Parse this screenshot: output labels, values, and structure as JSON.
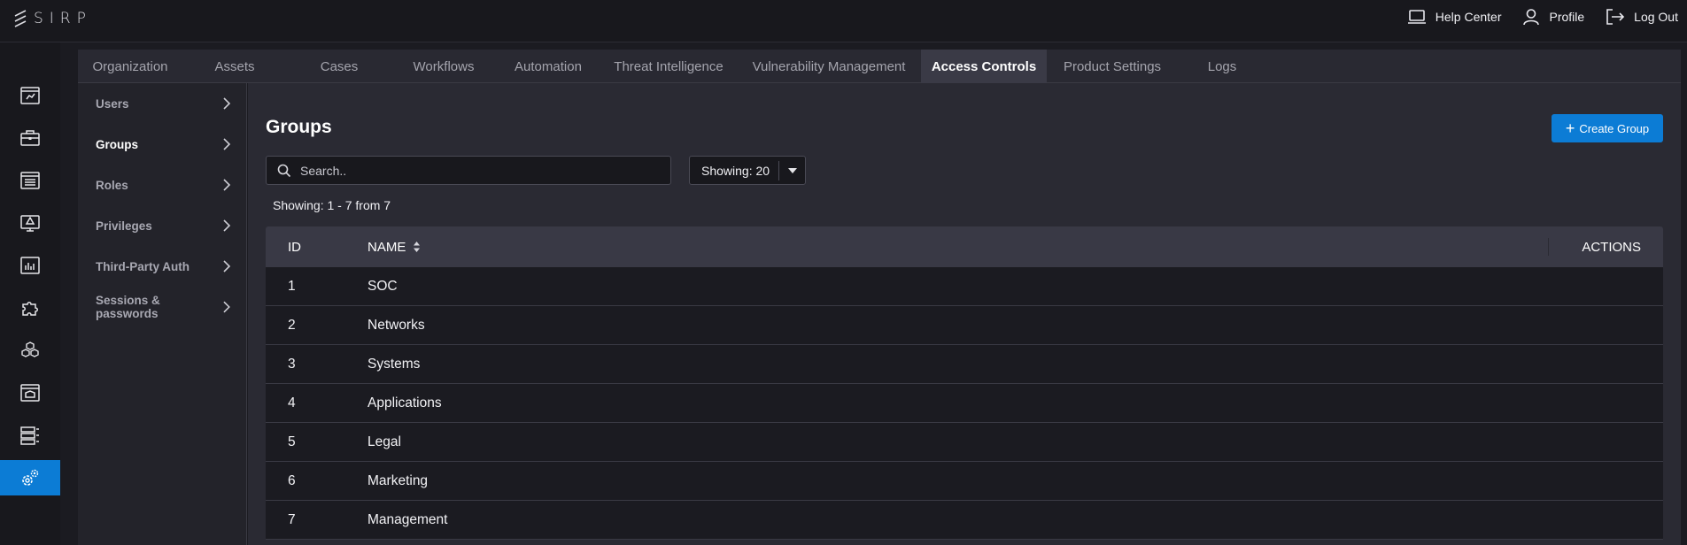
{
  "app": {
    "logo_text": "SIRP"
  },
  "top_actions": [
    {
      "label": "Help Center",
      "icon": "laptop-icon"
    },
    {
      "label": "Profile",
      "icon": "user-icon"
    },
    {
      "label": "Log Out",
      "icon": "logout-icon"
    }
  ],
  "rail": [
    "dashboard-icon",
    "briefcase-icon",
    "list-icon",
    "monitor-alert-icon",
    "analytics-icon",
    "puzzle-icon",
    "cubes-icon",
    "browser-window-icon",
    "server-icon",
    "settings-gears-icon"
  ],
  "tabs": [
    {
      "label": "Organization"
    },
    {
      "label": "Assets"
    },
    {
      "label": "Cases"
    },
    {
      "label": "Workflows"
    },
    {
      "label": "Automation"
    },
    {
      "label": "Threat Intelligence"
    },
    {
      "label": "Vulnerability Management"
    },
    {
      "label": "Access Controls",
      "active": true
    },
    {
      "label": "Product Settings"
    },
    {
      "label": "Logs"
    }
  ],
  "subnav": [
    {
      "label": "Users"
    },
    {
      "label": "Groups",
      "active": true
    },
    {
      "label": "Roles"
    },
    {
      "label": "Privileges"
    },
    {
      "label": "Third-Party Auth"
    },
    {
      "label": "Sessions & passwords"
    }
  ],
  "main": {
    "title": "Groups",
    "create_button": "Create Group",
    "search_placeholder": "Search..",
    "page_size": "Showing: 20",
    "count_text": "Showing: 1 - 7 from 7"
  },
  "table": {
    "columns": {
      "id": "ID",
      "name": "NAME",
      "actions": "ACTIONS"
    },
    "rows": [
      {
        "id": "1",
        "name": "SOC"
      },
      {
        "id": "2",
        "name": "Networks"
      },
      {
        "id": "3",
        "name": "Systems"
      },
      {
        "id": "4",
        "name": "Applications"
      },
      {
        "id": "5",
        "name": "Legal"
      },
      {
        "id": "6",
        "name": "Marketing"
      },
      {
        "id": "7",
        "name": "Management"
      }
    ]
  },
  "colors": {
    "accent": "#0c7cd5",
    "background": "#1b1b21",
    "panel": "#2a2a33"
  }
}
